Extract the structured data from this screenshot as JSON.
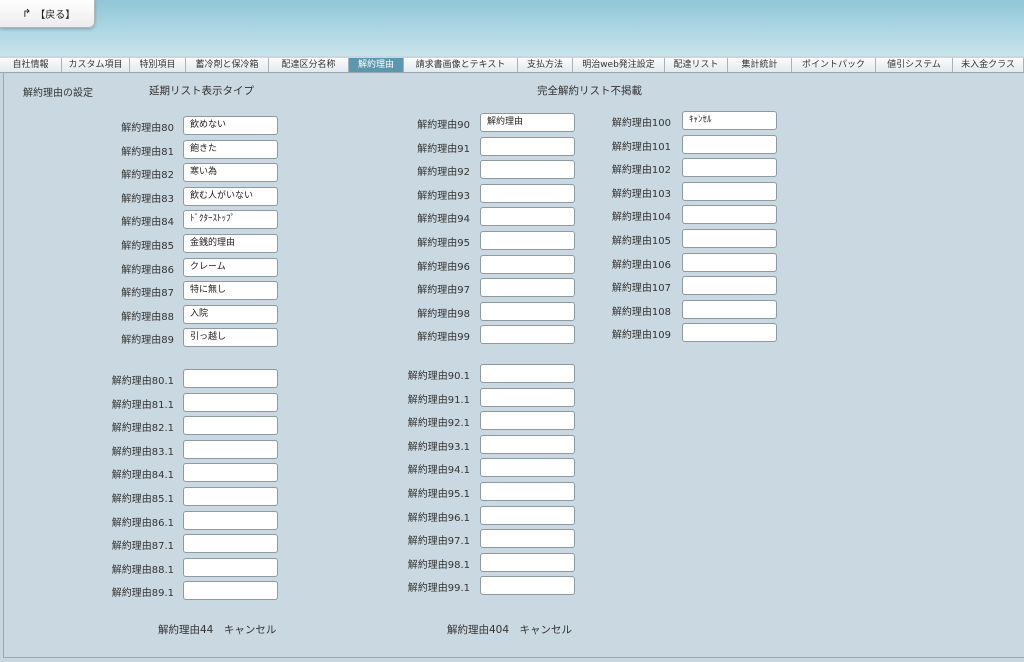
{
  "header": {
    "back_label": "【戻る】"
  },
  "tabs": [
    {
      "label": "自社情報",
      "active": false
    },
    {
      "label": "カスタム項目",
      "active": false
    },
    {
      "label": "特別項目",
      "active": false
    },
    {
      "label": "蓄冷剤と保冷箱",
      "active": false
    },
    {
      "label": "配達区分名称",
      "active": false
    },
    {
      "label": "解約理由",
      "active": true
    },
    {
      "label": "請求書画像とテキスト",
      "active": false
    },
    {
      "label": "支払方法",
      "active": false
    },
    {
      "label": "明治web発注設定",
      "active": false
    },
    {
      "label": "配達リスト",
      "active": false
    },
    {
      "label": "集計統計",
      "active": false
    },
    {
      "label": "ポイントパック",
      "active": false
    },
    {
      "label": "値引システム",
      "active": false
    },
    {
      "label": "未入金クラス",
      "active": false
    }
  ],
  "page": {
    "settings_label": "解約理由の設定",
    "deferred_title": "延期リスト表示タイプ",
    "full_cancel_title": "完全解約リスト不掲載"
  },
  "col1_main": [
    {
      "label": "解約理由80",
      "value": "飲めない"
    },
    {
      "label": "解約理由81",
      "value": "飽きた"
    },
    {
      "label": "解約理由82",
      "value": "寒い為"
    },
    {
      "label": "解約理由83",
      "value": "飲む人がいない"
    },
    {
      "label": "解約理由84",
      "value": "ﾄﾞｸﾀｰｽﾄｯﾌﾟ"
    },
    {
      "label": "解約理由85",
      "value": "金銭的理由"
    },
    {
      "label": "解約理由86",
      "value": "クレーム"
    },
    {
      "label": "解約理由87",
      "value": "特に無し"
    },
    {
      "label": "解約理由88",
      "value": "入院"
    },
    {
      "label": "解約理由89",
      "value": "引っ越し"
    }
  ],
  "col1_sub": [
    {
      "label": "解約理由80.1",
      "value": ""
    },
    {
      "label": "解約理由81.1",
      "value": ""
    },
    {
      "label": "解約理由82.1",
      "value": ""
    },
    {
      "label": "解約理由83.1",
      "value": ""
    },
    {
      "label": "解約理由84.1",
      "value": ""
    },
    {
      "label": "解約理由85.1",
      "value": ""
    },
    {
      "label": "解約理由86.1",
      "value": ""
    },
    {
      "label": "解約理由87.1",
      "value": ""
    },
    {
      "label": "解約理由88.1",
      "value": ""
    },
    {
      "label": "解約理由89.1",
      "value": ""
    }
  ],
  "col2_main": [
    {
      "label": "解約理由90",
      "value": "解約理由"
    },
    {
      "label": "解約理由91",
      "value": ""
    },
    {
      "label": "解約理由92",
      "value": ""
    },
    {
      "label": "解約理由93",
      "value": ""
    },
    {
      "label": "解約理由94",
      "value": ""
    },
    {
      "label": "解約理由95",
      "value": ""
    },
    {
      "label": "解約理由96",
      "value": ""
    },
    {
      "label": "解約理由97",
      "value": ""
    },
    {
      "label": "解約理由98",
      "value": ""
    },
    {
      "label": "解約理由99",
      "value": ""
    }
  ],
  "col2_sub": [
    {
      "label": "解約理由90.1",
      "value": ""
    },
    {
      "label": "解約理由91.1",
      "value": ""
    },
    {
      "label": "解約理由92.1",
      "value": ""
    },
    {
      "label": "解約理由93.1",
      "value": ""
    },
    {
      "label": "解約理由94.1",
      "value": ""
    },
    {
      "label": "解約理由95.1",
      "value": ""
    },
    {
      "label": "解約理由96.1",
      "value": ""
    },
    {
      "label": "解約理由97.1",
      "value": ""
    },
    {
      "label": "解約理由98.1",
      "value": ""
    },
    {
      "label": "解約理由99.1",
      "value": ""
    }
  ],
  "col3_main": [
    {
      "label": "解約理由100",
      "value": "ｷｬﾝｾﾙ"
    },
    {
      "label": "解約理由101",
      "value": ""
    },
    {
      "label": "解約理由102",
      "value": ""
    },
    {
      "label": "解約理由103",
      "value": ""
    },
    {
      "label": "解約理由104",
      "value": ""
    },
    {
      "label": "解約理由105",
      "value": ""
    },
    {
      "label": "解約理由106",
      "value": ""
    },
    {
      "label": "解約理由107",
      "value": ""
    },
    {
      "label": "解約理由108",
      "value": ""
    },
    {
      "label": "解約理由109",
      "value": ""
    }
  ],
  "footer": {
    "left_text": "解約理由44　キャンセル",
    "right_text": "解約理由404　キャンセル"
  }
}
